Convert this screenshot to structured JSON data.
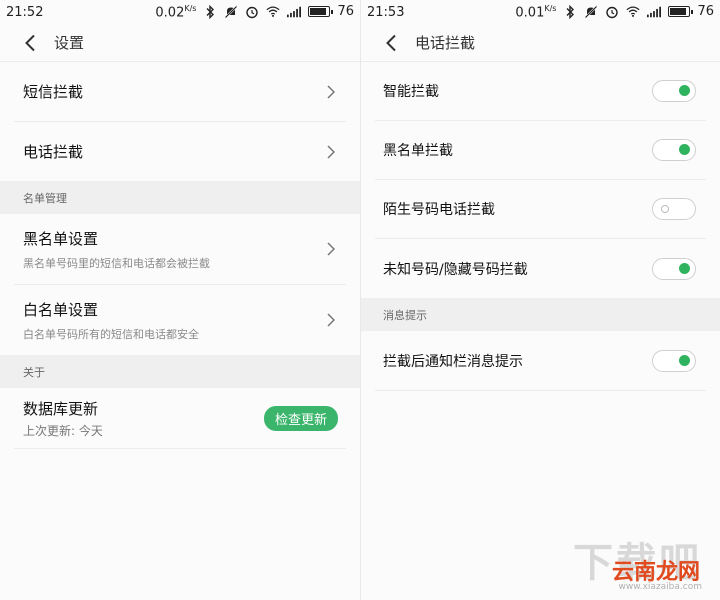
{
  "left": {
    "status": {
      "time": "21:52",
      "speed": "0.02",
      "speed_unit": "K/s",
      "battery": "76",
      "battery_level": 0.76
    },
    "title": "设置",
    "rows": {
      "sms_block": "短信拦截",
      "call_block": "电话拦截"
    },
    "section_list_mgmt": "名单管理",
    "blacklist": {
      "label": "黑名单设置",
      "sub": "黑名单号码里的短信和电话都会被拦截"
    },
    "whitelist": {
      "label": "白名单设置",
      "sub": "白名单号码所有的短信和电话都安全"
    },
    "section_about": "关于",
    "database": {
      "label": "数据库更新",
      "sub": "上次更新: 今天",
      "button": "检查更新"
    }
  },
  "right": {
    "status": {
      "time": "21:53",
      "speed": "0.01",
      "speed_unit": "K/s",
      "battery": "76",
      "battery_level": 0.76
    },
    "title": "电话拦截",
    "toggles": [
      {
        "label": "智能拦截",
        "on": true
      },
      {
        "label": "黑名单拦截",
        "on": true
      },
      {
        "label": "陌生号码电话拦截",
        "on": false
      },
      {
        "label": "未知号码/隐藏号码拦截",
        "on": true
      }
    ],
    "section_notify": "消息提示",
    "notify_toggle": {
      "label": "拦截后通知栏消息提示",
      "on": true
    }
  },
  "watermark": {
    "top": "下载吧",
    "url": "www.xiazaiba.com",
    "brand": "云南龙网"
  },
  "colors": {
    "accent_green": "#3bb56c",
    "toggle_green": "#2fb35f",
    "section_bg": "#efefef"
  },
  "icons": [
    "back-arrow-icon",
    "chevron-right-icon",
    "bluetooth-icon",
    "mute-icon",
    "alarm-icon",
    "wifi-icon",
    "signal-icon",
    "battery-icon"
  ]
}
